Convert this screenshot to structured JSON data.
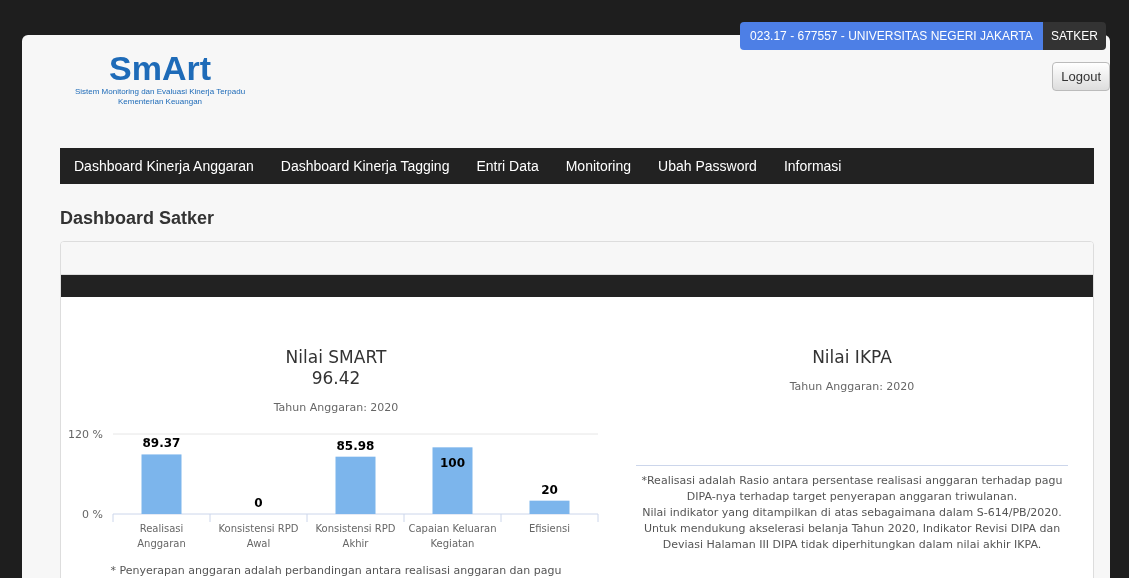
{
  "user_badge": {
    "unit": "023.17 - 677557 - UNIVERSITAS NEGERI JAKARTA",
    "role": "SATKER"
  },
  "logout": "Logout",
  "logo": {
    "text": "SmArt",
    "subtitle": "Sistem Monitoring dan Evaluasi Kinerja Terpadu",
    "ministry": "Kementerian Keuangan"
  },
  "nav": [
    {
      "label": "Dashboard Kinerja Anggaran"
    },
    {
      "label": "Dashboard Kinerja Tagging"
    },
    {
      "label": "Entri Data"
    },
    {
      "label": "Monitoring"
    },
    {
      "label": "Ubah Password"
    },
    {
      "label": "Informasi"
    }
  ],
  "heading": "Dashboard Satker",
  "smart": {
    "title": "Nilai SMART",
    "score": "96.42",
    "year": "Tahun Anggaran: 2020",
    "chart_data": {
      "type": "bar",
      "categories": [
        "Realisasi Anggaran",
        "Konsistensi RPD Awal",
        "Konsistensi RPD Akhir",
        "Capaian Keluaran Kegiatan",
        "Efisiensi"
      ],
      "series": [
        {
          "color": "#7cb5ec",
          "values": [
            89.37,
            0,
            85.98,
            100,
            20
          ]
        }
      ],
      "ylim": [
        0,
        120
      ],
      "yticks": [
        {
          "value": 0,
          "label": "0 %"
        },
        {
          "value": 120,
          "label": "120 %"
        }
      ],
      "data_labels": true
    },
    "note": "* Penyerapan anggaran adalah perbandingan antara realisasi anggaran dan pagu"
  },
  "ikpa": {
    "title": "Nilai IKPA",
    "year": "Tahun Anggaran: 2020",
    "notes": [
      "*Realisasi adalah Rasio antara persentase realisasi anggaran terhadap pagu DIPA-nya terhadap target penyerapan anggaran triwulanan.",
      "Nilai indikator yang ditampilkan di atas sebagaimana dalam S-614/PB/2020.",
      "Untuk mendukung akselerasi belanja Tahun 2020, Indikator Revisi DIPA dan Deviasi Halaman III DIPA tidak diperhitungkan dalam nilai akhir IKPA."
    ]
  }
}
